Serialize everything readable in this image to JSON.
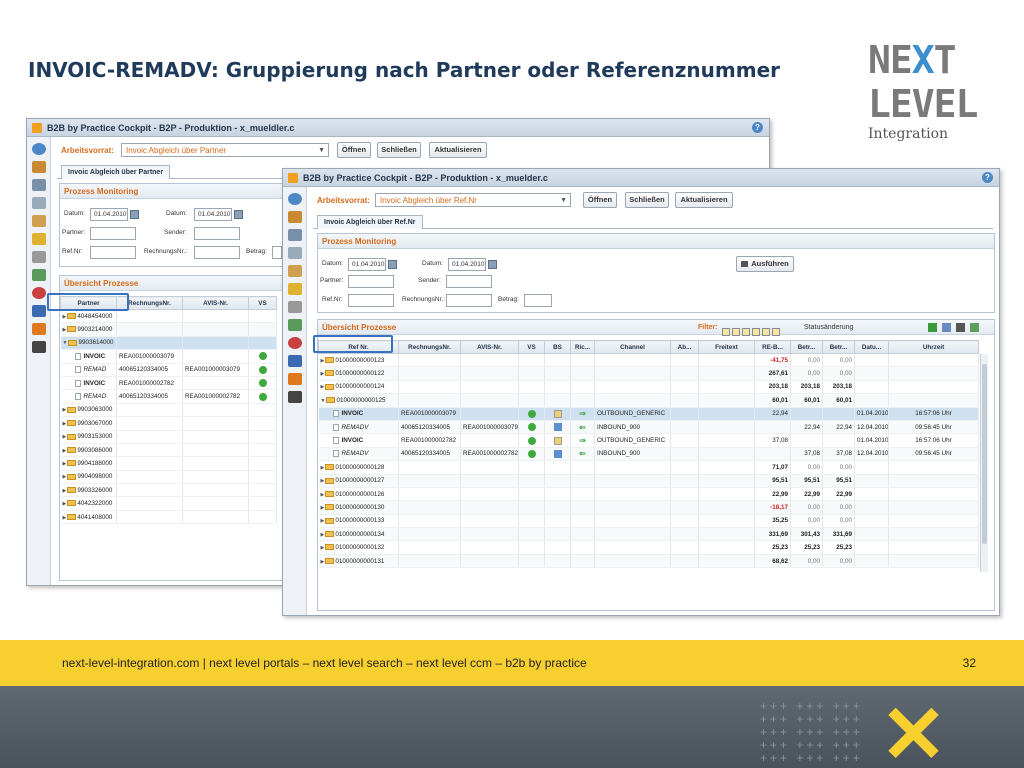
{
  "slide": {
    "title": "INVOIC-REMADV: Gruppierung nach Partner oder Referenznummer",
    "logo": {
      "line1a": "NE",
      "line1x": "X",
      "line1b": "T",
      "line2": "LEVEL",
      "line3": "Integration"
    },
    "footer": "next-level-integration.com | next level portals –  next level search – next level ccm – b2b by practice",
    "page_number": "32"
  },
  "win_back": {
    "title": "B2B by Practice Cockpit - B2P - Produktion - x_mueldler.c",
    "arbeitsvorrat_label": "Arbeitsvorrat:",
    "arbeitsvorrat_value": "Invoic Abgleich über Partner",
    "btn_open": "Öffnen",
    "btn_close": "Schließen",
    "btn_refresh": "Aktualisieren",
    "tab": "Invoic Abgleich über Partner",
    "monitoring_title": "Prozess Monitoring",
    "datum_label": "Datum:",
    "datum_from": "01.04.2010",
    "datum2_label": "Datum:",
    "datum_to": "01.04.2010",
    "partner_label": "Partner:",
    "sender_label": "Sender:",
    "refnr_label": "Ref.Nr:",
    "rechnungsnr_label": "RechnungsNr.:",
    "betrag_label": "Betrag:",
    "overview_title": "Übersicht Prozesse",
    "columns": [
      "Partner",
      "RechnungsNr.",
      "AVIS-Nr.",
      "VS"
    ],
    "rows": [
      {
        "partner": "4048454000",
        "re": "",
        "avis": ""
      },
      {
        "partner": "9903214000",
        "re": "",
        "avis": ""
      },
      {
        "partner": "9903614000",
        "re": "",
        "avis": ""
      },
      {
        "partner": "INVOIC",
        "re": "REA001000003079",
        "avis": ""
      },
      {
        "partner": "REMAD",
        "re": "40065120334005",
        "avis": "REA001000003079"
      },
      {
        "partner": "INVOIC",
        "re": "REA001000002782",
        "avis": ""
      },
      {
        "partner": "REMAD",
        "re": "40065120334005",
        "avis": "REA001000002782"
      },
      {
        "partner": "9903063000",
        "re": "",
        "avis": ""
      },
      {
        "partner": "9903067000",
        "re": "",
        "avis": ""
      },
      {
        "partner": "9903153000",
        "re": "",
        "avis": ""
      },
      {
        "partner": "9903086000",
        "re": "",
        "avis": ""
      },
      {
        "partner": "9904188000",
        "re": "",
        "avis": ""
      },
      {
        "partner": "9904098000",
        "re": "",
        "avis": ""
      },
      {
        "partner": "9903326000",
        "re": "",
        "avis": ""
      },
      {
        "partner": "4042322000",
        "re": "",
        "avis": ""
      },
      {
        "partner": "4041408000",
        "re": "",
        "avis": ""
      }
    ]
  },
  "win_front": {
    "title": "B2B by Practice Cockpit - B2P - Produktion - x_muelder.c",
    "arbeitsvorrat_label": "Arbeitsvorrat:",
    "arbeitsvorrat_value": "Invoic Abgleich über Ref.Nr",
    "btn_open": "Öffnen",
    "btn_close": "Schließen",
    "btn_refresh": "Aktualisieren",
    "tab": "Invoic Abgleich über Ref.Nr",
    "monitoring_title": "Prozess Monitoring",
    "datum_label": "Datum:",
    "datum_from": "01.04.2010",
    "datum2_label": "Datum:",
    "datum_to": "01.04.2010",
    "partner_label": "Partner:",
    "sender_label": "Sender:",
    "refnr_label": "Ref.Nr:",
    "rechnungsnr_label": "RechnungsNr.:",
    "betrag_label": "Betrag:",
    "btn_execute": "Ausführen",
    "overview_title": "Übersicht Prozesse",
    "filter_label": "Filter:",
    "status_change": "Statusänderung",
    "columns": [
      "Ref Nr.",
      "RechnungsNr.",
      "AVIS-Nr.",
      "VS",
      "BS",
      "Ric...",
      "Channel",
      "Ab...",
      "Freitext",
      "RE-B...",
      "Betr...",
      "Betr...",
      "Datu...",
      "Uhrzeit"
    ],
    "rows": [
      {
        "ref": "01000000000123",
        "re": "",
        "avis": "",
        "channel": "",
        "reb": "-41,75",
        "b1": "0,00",
        "b2": "0,00",
        "datum": "",
        "zeit": ""
      },
      {
        "ref": "01000000000122",
        "re": "",
        "avis": "",
        "channel": "",
        "reb": "267,61",
        "b1": "0,00",
        "b2": "0,00",
        "datum": "",
        "zeit": ""
      },
      {
        "ref": "01000000000124",
        "re": "",
        "avis": "",
        "channel": "",
        "reb": "203,18",
        "b1": "203,18",
        "b2": "203,18",
        "datum": "",
        "zeit": ""
      },
      {
        "ref": "01000000000125",
        "re": "",
        "avis": "",
        "channel": "",
        "reb": "60,01",
        "b1": "60,01",
        "b2": "60,01",
        "datum": "",
        "zeit": ""
      },
      {
        "ref": "INVOIC",
        "re": "REA001000003079",
        "avis": "",
        "channel": "OUTBOUND_GENERIC",
        "reb": "22,94",
        "b1": "",
        "b2": "",
        "datum": "01.04.2010",
        "zeit": "16:57:06 Uhr"
      },
      {
        "ref": "REMADV",
        "re": "40065120334005",
        "avis": "REA001000003079",
        "channel": "INBOUND_900",
        "reb": "",
        "b1": "22,94",
        "b2": "22,94",
        "datum": "12.04.2010",
        "zeit": "09:56:45 Uhr"
      },
      {
        "ref": "INVOIC",
        "re": "REA001000002782",
        "avis": "",
        "channel": "OUTBOUND_GENERIC",
        "reb": "37,08",
        "b1": "",
        "b2": "",
        "datum": "01.04.2010",
        "zeit": "16:57:06 Uhr"
      },
      {
        "ref": "REMADV",
        "re": "40065120334005",
        "avis": "REA001000002782",
        "channel": "INBOUND_900",
        "reb": "",
        "b1": "37,08",
        "b2": "37,08",
        "datum": "12.04.2010",
        "zeit": "09:56:45 Uhr"
      },
      {
        "ref": "01000000000128",
        "re": "",
        "avis": "",
        "channel": "",
        "reb": "71,07",
        "b1": "0,00",
        "b2": "0,00",
        "datum": "",
        "zeit": ""
      },
      {
        "ref": "01000000000127",
        "re": "",
        "avis": "",
        "channel": "",
        "reb": "95,51",
        "b1": "95,51",
        "b2": "95,51",
        "datum": "",
        "zeit": ""
      },
      {
        "ref": "01000000000126",
        "re": "",
        "avis": "",
        "channel": "",
        "reb": "22,99",
        "b1": "22,99",
        "b2": "22,99",
        "datum": "",
        "zeit": ""
      },
      {
        "ref": "01000000000130",
        "re": "",
        "avis": "",
        "channel": "",
        "reb": "-18,17",
        "b1": "0,00",
        "b2": "0,00",
        "datum": "",
        "zeit": ""
      },
      {
        "ref": "01000000000133",
        "re": "",
        "avis": "",
        "channel": "",
        "reb": "35,25",
        "b1": "0,00",
        "b2": "0,00",
        "datum": "",
        "zeit": ""
      },
      {
        "ref": "01000000000134",
        "re": "",
        "avis": "",
        "channel": "",
        "reb": "331,69",
        "b1": "301,43",
        "b2": "331,69",
        "datum": "",
        "zeit": ""
      },
      {
        "ref": "01000000000132",
        "re": "",
        "avis": "",
        "channel": "",
        "reb": "25,23",
        "b1": "25,23",
        "b2": "25,23",
        "datum": "",
        "zeit": ""
      },
      {
        "ref": "01000000000131",
        "re": "",
        "avis": "",
        "channel": "",
        "reb": "68,62",
        "b1": "0,00",
        "b2": "0,00",
        "datum": "",
        "zeit": ""
      }
    ]
  },
  "colors": {
    "accent_orange": "#d66a1a",
    "title_blue": "#1f3a5a",
    "footer_yellow": "#f7d030",
    "highlight_blue": "#3a72c0"
  }
}
